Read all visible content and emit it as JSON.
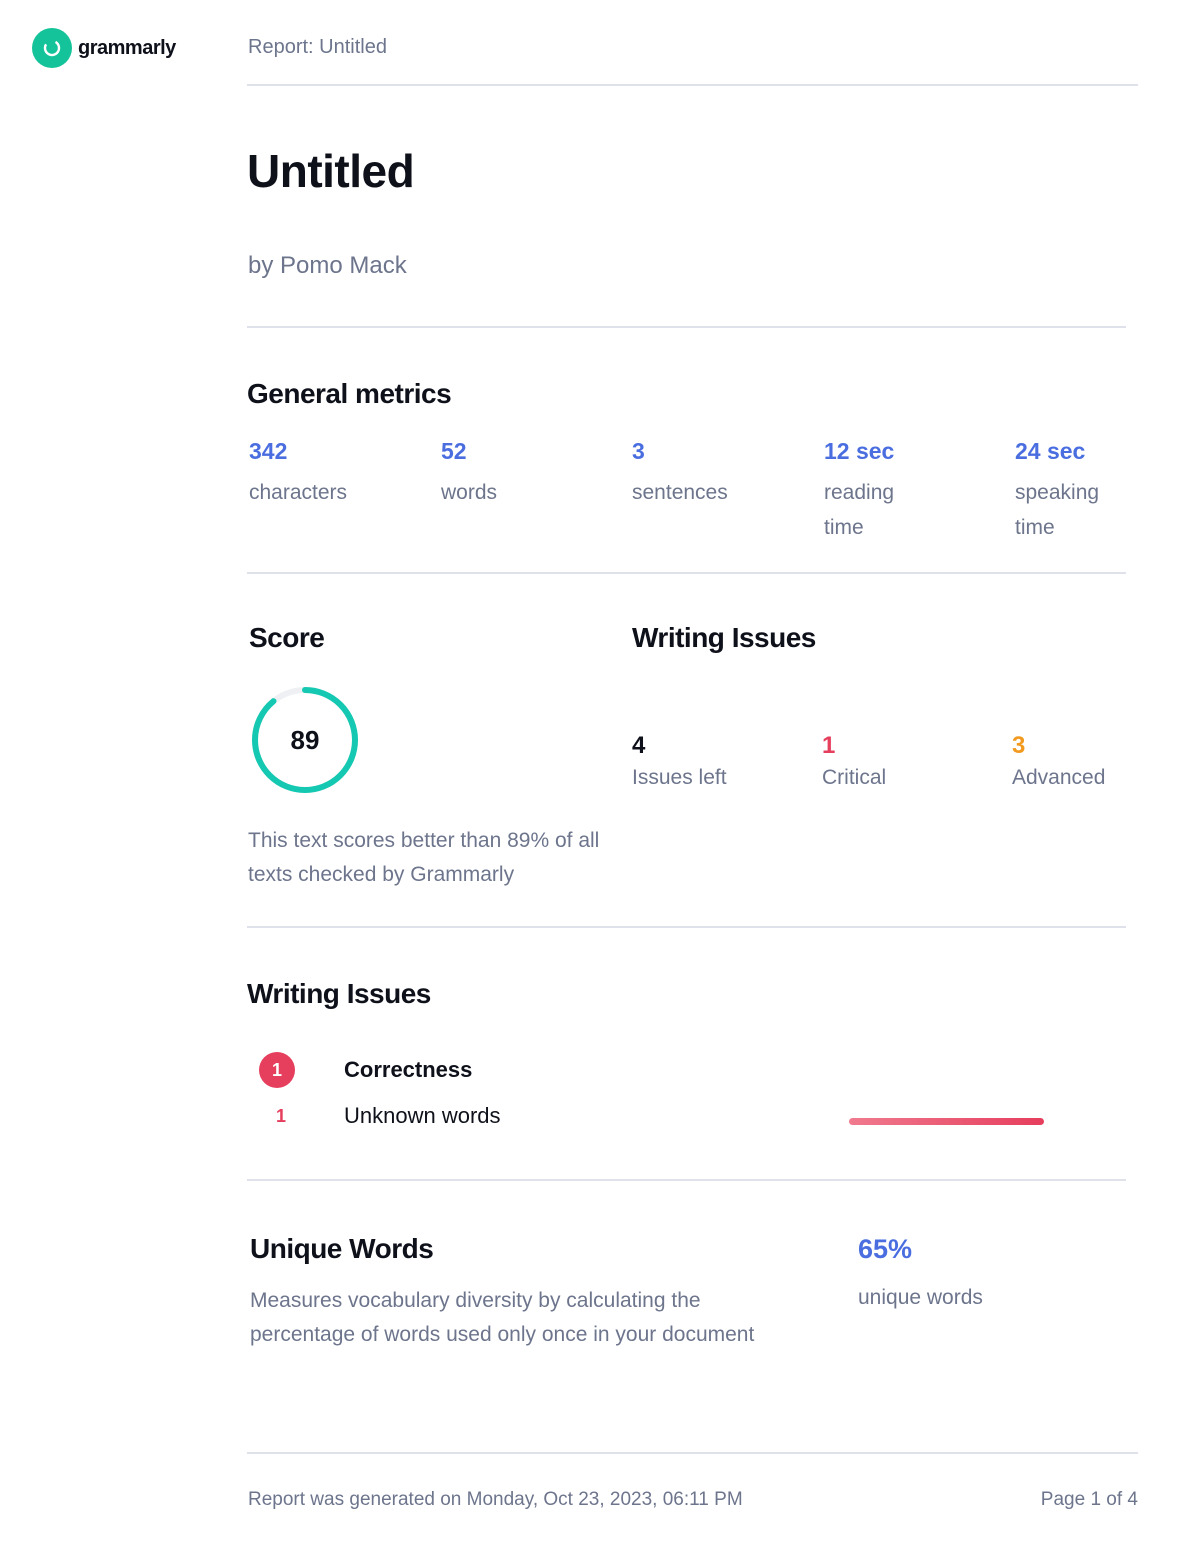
{
  "header": {
    "logo_text": "grammarly",
    "report_label": "Report: Untitled"
  },
  "document": {
    "title": "Untitled",
    "author": "by Pomo Mack"
  },
  "general_metrics": {
    "heading": "General metrics",
    "items": [
      {
        "value": "342",
        "label": "characters"
      },
      {
        "value": "52",
        "label": "words"
      },
      {
        "value": "3",
        "label": "sentences"
      },
      {
        "value": "12 sec",
        "label": "reading time"
      },
      {
        "value": "24 sec",
        "label": "speaking time"
      }
    ]
  },
  "score": {
    "heading": "Score",
    "value": "89",
    "fraction": 0.89,
    "description": "This text scores better than 89% of all texts checked by Grammarly",
    "ring_color": "#15c8b1"
  },
  "writing_issues_summary": {
    "heading": "Writing Issues",
    "items": [
      {
        "value": "4",
        "label": "Issues left",
        "color": "#0e101a"
      },
      {
        "value": "1",
        "label": "Critical",
        "color": "#e63e5d"
      },
      {
        "value": "3",
        "label": "Advanced",
        "color": "#f29a1f"
      }
    ]
  },
  "writing_issues_detail": {
    "heading": "Writing Issues",
    "category": {
      "count": "1",
      "label": "Correctness"
    },
    "subitems": [
      {
        "count": "1",
        "label": "Unknown words",
        "fraction": 1.0
      }
    ]
  },
  "unique_words": {
    "heading": "Unique Words",
    "description": "Measures vocabulary diversity by calculating the percentage of words used only once in your document",
    "value": "65%",
    "label": "unique words"
  },
  "footer": {
    "generated": "Report was generated on Monday, Oct 23, 2023, 06:11 PM",
    "page": "Page 1 of 4"
  },
  "colors": {
    "brand": "#15c39a",
    "accent": "#4a6ee0",
    "critical": "#e63e5d",
    "advanced": "#f29a1f",
    "muted": "#6d758d"
  }
}
